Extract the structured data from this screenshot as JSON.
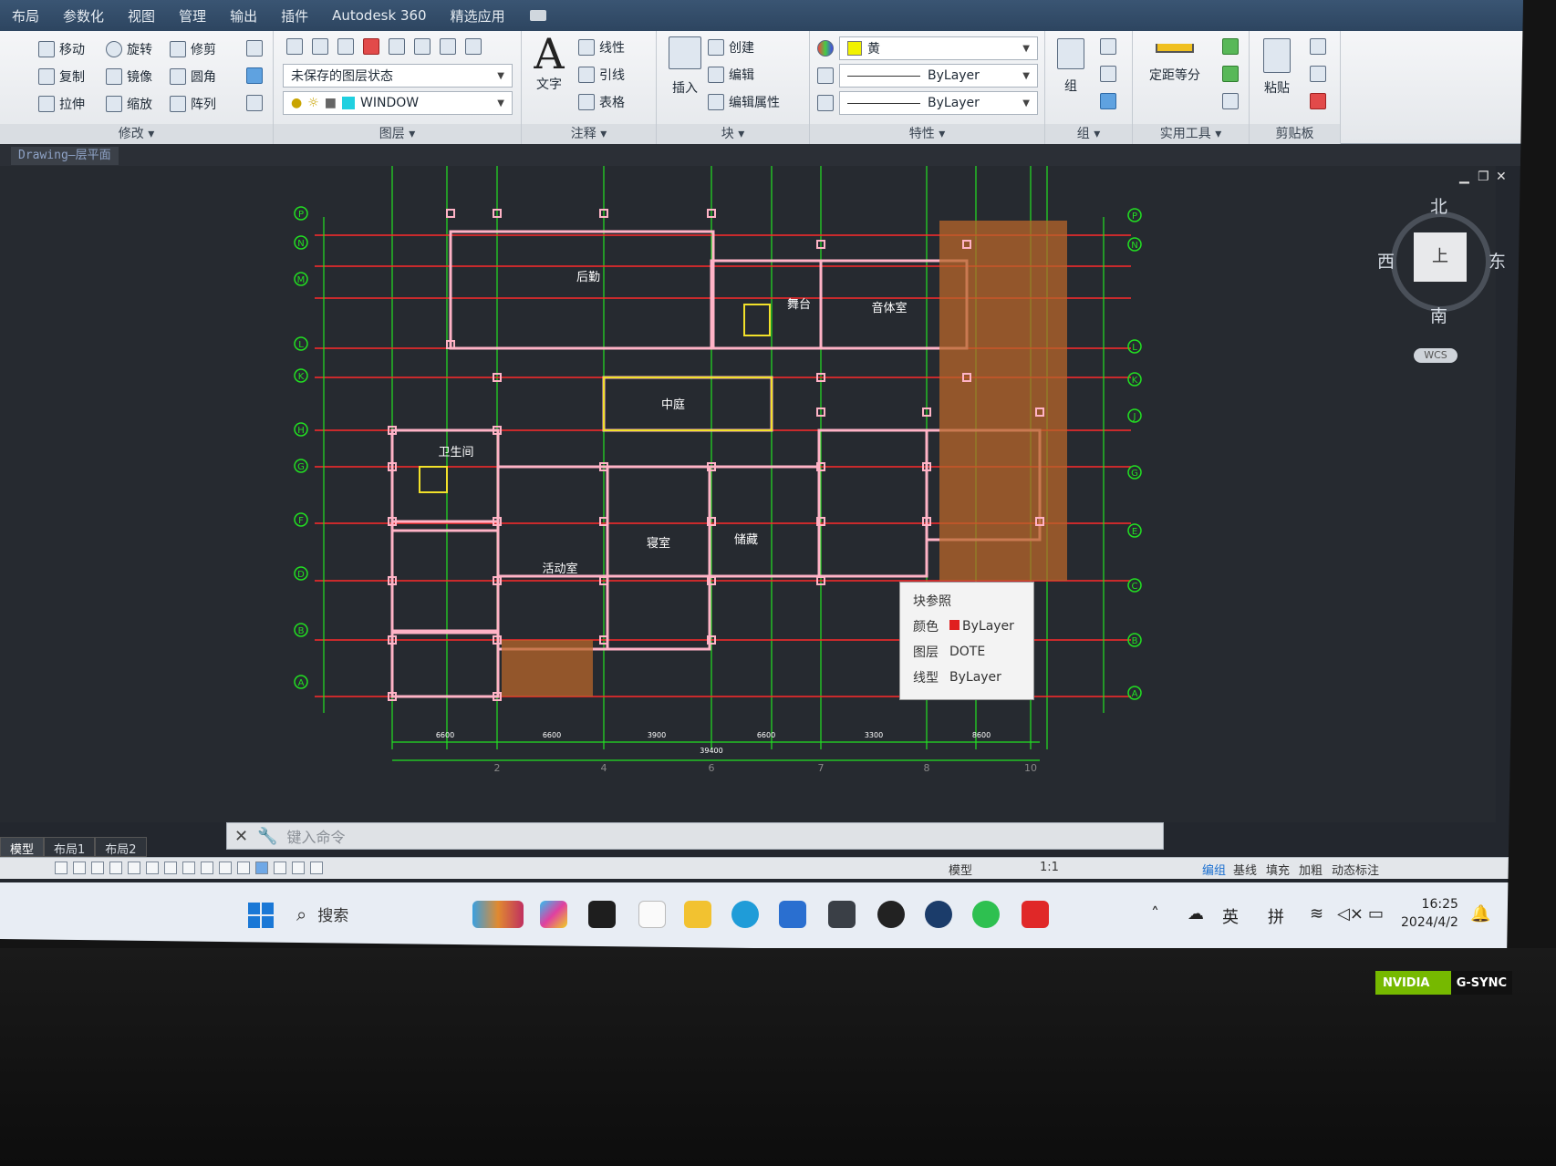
{
  "menu": {
    "items": [
      "布局",
      "参数化",
      "视图",
      "管理",
      "输出",
      "插件",
      "Autodesk 360",
      "精选应用"
    ]
  },
  "ribbon": {
    "modify": {
      "title": "修改 ▾",
      "tools": [
        "移动",
        "旋转",
        "修剪",
        "复制",
        "镜像",
        "圆角",
        "拉伸",
        "缩放",
        "阵列"
      ]
    },
    "layers": {
      "title": "图层 ▾",
      "state": "未保存的图层状态",
      "current_layer": "WINDOW"
    },
    "annotation": {
      "title": "注释 ▾",
      "text_label": "文字",
      "tools": [
        "线性",
        "引线",
        "表格"
      ]
    },
    "block": {
      "title": "块 ▾",
      "insert_label": "插入",
      "tools": [
        "创建",
        "编辑",
        "编辑属性"
      ]
    },
    "properties": {
      "title": "特性 ▾",
      "color": "黄",
      "linetype": "ByLayer",
      "lineweight": "ByLayer"
    },
    "groups": {
      "title": "组 ▾",
      "label": "组"
    },
    "utilities": {
      "title": "实用工具 ▾",
      "label": "定距等分"
    },
    "clipboard": {
      "title": "剪贴板",
      "label": "粘贴"
    }
  },
  "document": {
    "tab": "Drawing—层平面"
  },
  "plan": {
    "rooms": [
      "后勤",
      "舞台",
      "音体室",
      "中庭",
      "活动室",
      "寝室",
      "卫生间",
      "储藏"
    ],
    "axis_left": [
      "P",
      "N",
      "M",
      "L",
      "K",
      "H",
      "G",
      "F",
      "D",
      "B",
      "A"
    ],
    "axis_right": [
      "P",
      "N",
      "L",
      "K",
      "J",
      "G",
      "E",
      "C",
      "B",
      "A"
    ],
    "axis_bottom": [
      "2",
      "4",
      "6",
      "7",
      "8",
      "10"
    ],
    "dim_bottom": [
      "6600",
      "6600",
      "3900",
      "6600",
      "3300",
      "8600"
    ],
    "dim_total": "39400"
  },
  "viewcube": {
    "north": "北",
    "south": "南",
    "west": "西",
    "east": "东",
    "face": "上",
    "wcs": "WCS"
  },
  "tooltip": {
    "title": "块参照",
    "rows": [
      {
        "label": "颜色",
        "value": "ByLayer"
      },
      {
        "label": "图层",
        "value": "DOTE"
      },
      {
        "label": "线型",
        "value": "ByLayer"
      }
    ]
  },
  "command": {
    "placeholder": "键入命令"
  },
  "layout_tabs": [
    "模型",
    "布局1",
    "布局2"
  ],
  "statusbar": {
    "model": "模型",
    "scale": "1:1",
    "toggles": [
      "编组",
      "基线",
      "填充",
      "加粗",
      "动态标注"
    ]
  },
  "taskbar": {
    "search": "搜索",
    "tray": [
      "英",
      "拼"
    ],
    "time": "16:25",
    "date": "2024/4/2"
  },
  "bezel": {
    "brand": "NVIDIA",
    "sync": "G-SYNC"
  },
  "colors": {
    "cad_bg": "#262a30",
    "axis_green": "#22e022",
    "wall_red": "#ff2a2a",
    "wall_pink": "#ffb3c6",
    "yellow": "#f2e12a",
    "hatch": "#b8662a"
  }
}
